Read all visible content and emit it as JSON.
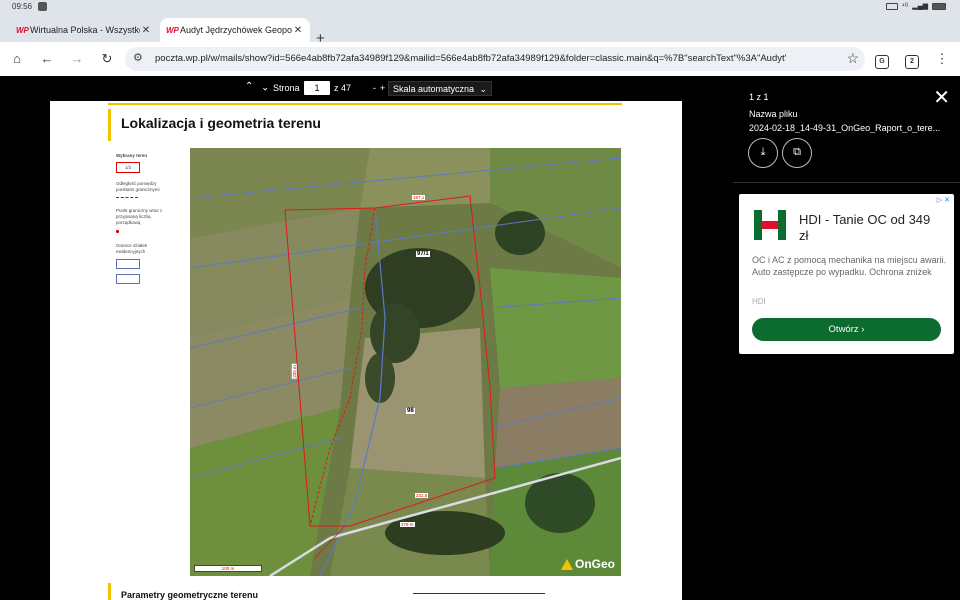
{
  "status_bar": {
    "time": "09:56"
  },
  "tabs": [
    {
      "favicon": "WP",
      "title": "Wirtualna Polska - Wszystko c",
      "close": "✕"
    },
    {
      "favicon": "WP",
      "title": "Audyt Jędrzychówek Geopo",
      "close": "✕"
    }
  ],
  "new_tab": "+",
  "toolbar": {
    "url": "poczta.wp.pl/w/mails/show?id=566e4ab8fb72afa34989f129&mailid=566e4ab8fb72afa34989f129&folder=classic.main&q=%7B\"searchText\"%3A\"Audyt'",
    "tab_count": "2"
  },
  "viewer": {
    "page_label": "Strona",
    "page_current": "1",
    "page_total": "z 47",
    "zoom_minus": "-",
    "zoom_plus": "+",
    "zoom_value": "Skala automatyczna"
  },
  "document": {
    "heading": "Lokalizacja i geometria terenu",
    "heading2": "Parametry geometryczne terenu",
    "legend": {
      "title": "Wybrany teren",
      "box_label": "1/2",
      "distance_text": "Odległość pomiędzy punktami granicznymi",
      "distance_value": "12,1",
      "point_text": "Punkt graniczny wraz z przypisaną liczbą porządkową",
      "parcel_text": "Granice działek ewidencyjnych"
    },
    "map": {
      "parcels": [
        "97/1",
        "98"
      ],
      "measures": [
        "197,1",
        "335 m",
        "276 m",
        "231,6",
        "100 m"
      ],
      "logo": "OnGeo"
    }
  },
  "side_panel": {
    "count": "1 z 1",
    "file_label": "Nazwa pliku",
    "file_name": "2024-02-18_14-49-31_OnGeo_Raport_o_tere...",
    "ad": {
      "title": "HDI - Tanie OC od 349 zł",
      "description": "OC i AC z pomocą mechanika na miejscu awarii. Auto zastępcze po wypadku. Ochrona zniżek",
      "source": "HDI",
      "button": "Otwórz"
    }
  },
  "colors": {
    "accent_yellow": "#f3c300",
    "ad_green": "#0c6b2e",
    "brand_red": "#e0102d"
  }
}
